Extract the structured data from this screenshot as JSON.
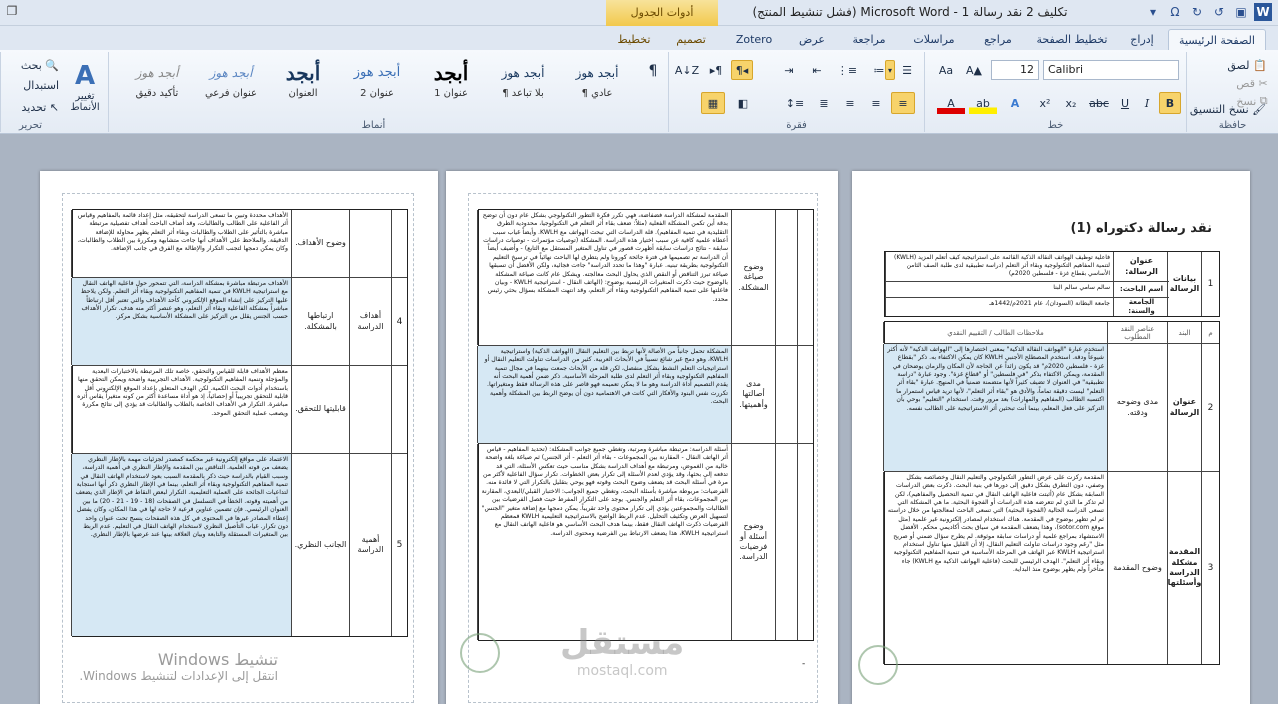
{
  "window": {
    "title": "تكليف 2 نقد رسالة 1 - Microsoft Word (فشل تنشيط المنتج)",
    "contextual_group": "أدوات الجدول"
  },
  "tabs": [
    {
      "label": "الصفحة الرئيسية",
      "active": true
    },
    {
      "label": "إدراج"
    },
    {
      "label": "تخطيط الصفحة"
    },
    {
      "label": "مراجع"
    },
    {
      "label": "مراسلات"
    },
    {
      "label": "مراجعة"
    },
    {
      "label": "عرض"
    },
    {
      "label": "Zotero"
    },
    {
      "label": "تصميم"
    },
    {
      "label": "تخطيط"
    }
  ],
  "ribbon": {
    "clipboard": {
      "label": "حافظة",
      "paste": "لصق",
      "cut": "قص",
      "copy": "نسخ",
      "format_painter": "نسخ التنسيق"
    },
    "font": {
      "label": "خط",
      "font_name": "Calibri",
      "font_size": "12"
    },
    "paragraph": {
      "label": "فقرة"
    },
    "styles": {
      "label": "أنماط",
      "items": [
        {
          "sample": "أبجد هوز",
          "name": "¶ عادي"
        },
        {
          "sample": "أبجد هوز",
          "name": "¶ بلا تباعد"
        },
        {
          "sample": "أبجد",
          "name": "عنوان 1"
        },
        {
          "sample": "أبجد هوز",
          "name": "عنوان 2"
        },
        {
          "sample": "أبجد",
          "name": "العنوان"
        },
        {
          "sample": "أبجد هوز",
          "name": "عنوان فرعي"
        },
        {
          "sample": "أبجد هوز",
          "name": "تأكيد دقيق"
        }
      ],
      "change_styles": "تغيير الأنماط"
    },
    "editing": {
      "label": "تحرير",
      "find": "بحث",
      "replace": "استبدال",
      "select": "تحديد"
    }
  },
  "document": {
    "page1": {
      "title": "نقد رسالة دكتوراه (1)",
      "info_rows": [
        {
          "num": "1",
          "section": "بيانات الرسالة",
          "fields": [
            {
              "label": "عنوان الرسالة:",
              "value": "فاعلية توظيف الهواتف النقالة الذكية القائمة على استراتيجية كيف أتعلم المزيد (KWLH) لتنمية المفاهيم التكنولوجية وبقاء أثر التعلم (دراسة تطبيقية لدى طلبة الصف الثامن الأساسي بقطاع غزة - فلسطين 2020م)"
            },
            {
              "label": "اسم الباحث:",
              "value": "سالم سامي سالم البنا"
            },
            {
              "label": "الجامعة والسنة:",
              "value": "جامعة البطانة (السودان)، عام 2021م/1442هـ"
            }
          ]
        }
      ],
      "eval_header": {
        "num": "م",
        "item": "البند",
        "criteria": "عناصر النقد المطلوب",
        "notes": "ملاحظات الطالب / التقييم النقدي"
      },
      "eval_rows": [
        {
          "num": "2",
          "item": "عنوان الرسالة",
          "criteria": "مدى وضوحه ودقته.",
          "text": "استخدم عبارة \"الهواتف النقالة الذكية\" بمعنى اختصارها إلى \"الهواتف الذكية\" لأنه أكثر شيوعاً ودقة. استخدم المصطلح الأجنبي KWLH كان يمكن الاكتفاء به. ذكر \"بقطاع غزة - فلسطين 2020م\" قد يكون زائداً عن الحاجة لأن المكان والزمان يوضحان في المقدمة، ويمكن الاكتفاء بذكر \"في فلسطين\" أو \"قطاع غزة\". وجود عبارة \"دراسة تطبيقية\" في العنوان لا تضيف كثيراً لأنها متضمنة ضمنياً في المنهج. عبارة \"بقاء أثر التعلم\" ليست دقيقة تماماً، والأدق هو \"بقاء أثر التعلم\"، لأنها تريد قياس استمرار ما اكتسبه الطالب (المفاهيم والمهارات) بعد مرور وقت. استخدام \"التعليم\" بوحي بأن التركيز على فعل المعلم، بينما أنت تبحثين أثر الاستراتيجية على الطالب نفسه.",
          "blue": true
        },
        {
          "num": "3",
          "item": "المقدمة مشكلة الدراسة وأسئلتها",
          "criteria": "وضوح المقدمة",
          "text": "المقدمة ركزت على عرض التطور التكنولوجي والتعليم النقال وخصائصه بشكل وصفي، دون التطرق بشكل دقيق إلى دورها في بنية البحث. ذكرت بعض الدراسات السابقة بشكل عام (أثبتت فاعلية الهاتف النقال في تنمية التحصيل والمفاهيم)، لكن لم تذكر ما الذي لم تتعرضه هذه الدراسات أو الفجوة البحثية. ما هي المشكلة التي تسعى الدراسة الحالية (الفجوة البحثية) التي تسعى الباحث لمعالجتها من خلال دراسته ثم لم تظهر بوضوح في المقدمة. هناك استخدام لمصادر إلكترونية غير علمية (مثل موقع sotor.com)، وهذا يضعف المقدمة في سياق بحث أكاديمي محكم. الأفضل الاستشهاد بمراجع علمية أو دراسات سابقة موثوقة. لم يطرح سؤال ضمني أو صريح مثل \"رغم وجود دراسات تناولت التعليم النقال، إلا أن القليل منها تناول استخدام استراتيجية KWLH عبر الهاتف في المرحلة الأساسية في تنمية المفاهيم التكنولوجية وبقاء أثر التعلم\". الهدف الرئيسي للبحث (فاعلية الهواتف الذكية مع KWLH) جاء متأخراً ولم يظهر بوضوح منذ البداية.",
          "blue": false
        }
      ]
    },
    "page2": {
      "rows": [
        {
          "criteria": "وضوح صياغة المشكلة.",
          "text": "المقدمة لمشكلة الدراسة فضفاضة، فهي تكرر فكرة التطور التكنولوجي بشكل عام دون أن توضح بدقة أين تكمن المشكلة الفعلية (مثلاً: ضعف بقاء أثر التعلم في التكنولوجيا، محدودية الطرق التقليدية في تنمية المفاهيم). قلة الدراسات التي تبحث الهواتف مع KWLH. وأيضاً غياب سبب أعطاه علمية كافية عن سبب اختيار هذه الدراسة. المشكلة (توصيات مؤتمرات - توصيات دراسات سابقة - نتائج دراسات سابقة أظهرت قصور في تناول المتغير المستقل مع التابع) - وأضيف أيضاً أن الدراسة تم تصميمها في فترة جائحة كورونا ولم يتطرق لها الباحث نهائياً في ترسيخ التعليم التكنولوجية بطريقة تبنيه. عبارة \"وهذا ما تحدد الدراسة\" جاءت فجائية، ولكن الأفضل أن تسبقها صياغة تبرز التناقض أو النقص الذي يحاول البحث معالجته. ويشكل عام كانت صياغة المشكلة بالوضوح حيث ذكرت المتغيرات الرئيسية بوضوح: (الهاتف النقال - استراتيجية KWLH - وبيان فاعلتها على تنمية المفاهيم التكنولوجية وبقاء أثر التعلم، وقد انتهت المشكلة بسؤال بحثي رئيس محدد.",
          "blue": false
        },
        {
          "criteria": "مدى أصالتها وأهميتها.",
          "text": "المشكلة تحمل جانباً من الأصالة لأنها تربط بين التعليم النقال (الهواتف الذكية) واستراتيجية KWLH، وهو دمج غير شائع نسبياً في الأبحاث العربية. كثير من الدراسات تناولت التعليم النقال أو استراتيجيات التعلم النشط بشكل منفصل، لكن قلة من الأبحاث جمعت بينهما في مجال تنمية المفاهيم التكنولوجية وبقاء أثر التعلم لدى طلبة المرحلة الأساسية. ذكر ضمن أهمية البحث أنه يقدم التصميم أداة الدراسة وهو ما لا يمكن تعميمه فهو قاصر على هذه الرسالة فقط ومتغيراتها. تكررت نفس البنود والأفكار التي كانت في الاهتمامية دون أن يوضح الربط بين المشكلة وأهمية البحث.",
          "blue": true
        },
        {
          "criteria": "وضوح أسئلة أو فرضيات الدراسة.",
          "text": "أسئلة الدراسة: مرتبطة مباشرة ومرتبة، وتغطي جميع جوانب المشكلة: (تحديد المفاهيم - قياس أثر الهاتف النقال - المقارنة بين المجموعات - بقاء أثر التعلم - أثر الجنس) ثم صياغة بلغة واضحة خالية من الغموض، ومرتبطة مع أهداف الدراسة بشكل مناسب حيث تعكس الأسئلة، التي قد تدفعه إلى بحثها، وقد يؤدي لعدم الأسئلة إلى تكرار بعض الخطوات. تكرار سؤال الفاعلية لأكثر من مرة في أسئلة البحث قد يضعف وضوح البحث وقوته فهو يوحي بتقليل بالتكرار التي لا فائدة منه. الفرضيات: مربوطة مباشرة بأسئلة البحث، وتغطي جميع الجوانب: الاختبار القبلي/البعدي، المقارنة بين المجموعات، بقاء أثر التعلم والجنس. يوجد على التكرار المفرط حيث فصل الفرضيات بين الطالبات والمجموعتين يؤدي إلى تكرار محتوى واحد تقريباً. يمكن دمجها مع إضافة متغير \"الجنس\" لتسهيل العرض وتكثيف التحليل. عدم الربط الواضح بالاستراتيجية التعليمية KWLH فمعظم الفرضيات ذكرت الهاتف النقال فقط، بينما هدف البحث الأساسي هو فاعلية الهاتف النقال مع استراتيجية KWLH، هذا يضعف الارتباط بين الفرضية ومحتوى الدراسة.",
          "blue": false
        }
      ],
      "footer_dash": "-"
    },
    "page3": {
      "rows": [
        {
          "num": "",
          "item": "",
          "criteria": "وضوح الأهداف.",
          "text": "الأهداف محددة وتبين ما تسعى الدراسة لتحقيقه، مثل إعداد قائمة بالمفاهيم وقياس أثر الفاعلية على الطالب والطالبات، وقد أضاف الباحث أهداف تفصيلية مرتبطة مباشرة بالتأثير على الطلاب والطالبات وبقاء أثر التعلم يظهر محاولة للإضافة الدقيقة. والملاحظ على الأهداف أنها جاءت متشابهة ومكررة بين الطلاب والطالبات، وكان يمكن دمجها لتجنب التكرار والإطالة مع الفرق في جانب الإضافة.",
          "blue": false
        },
        {
          "num": "4",
          "item": "أهداف الدراسة",
          "criteria": "ارتباطها بالمشكلة.",
          "text": "الأهداف مرتبطة مباشرة بمشكلة الدراسة، التي تتمحور حول فاعلية الهاتف النقال مع استراتيجية KWLH في تنمية المفاهيم التكنولوجية وبقاء أثر التعلم. ولكن يلاحظ عليها التركيز على إنشاء الموقع الإلكتروني كأحد الأهداف والتي تعتبر أقل ارتباطاً مباشراً بمشكلة الفاعلية وبقاء أثر التعلم، وهو عنصر أكثر منه هدف. تكرار الأهداف حسب الجنس يقلل من التركيز على المشكلة الأساسية بشكل مركز.",
          "blue": true
        },
        {
          "num": "",
          "item": "",
          "criteria": "قابليتها للتحقق.",
          "text": "معظم الأهداف قابلة للقياس والتحقق، خاصة تلك المرتبطة بالاختبارات البعدية والمؤجلة وتنمية المفاهيم التكنولوجية. الأهداف التجريبية واضحة ويمكن التحقق منها باستخدام أدوات البحث الكمية. لكن الهدف المتعلق بإعداد الموقع الإلكتروني أقل قابلية للتحقق تجريبياً أو إحصائياً، إذ هو أداة مساعدة أكثر من كونه متغيراً يقاس أثره مباشرة. التكرار في الأهداف الخاصة بالطلاب والطالبات قد يؤدي إلى نتائج مكررة ويصعب عملية التحقق الموحد.",
          "blue": false
        },
        {
          "num": "5",
          "item": "أهمية الدراسة",
          "criteria": "الجانب النظري.",
          "text": "الاعتماد على مواقع إلكترونية غير محكمة كمصدر لجزئيات مهمة بالإطار النظري يضعف من قوته العلمية. التناقض بين المقدمة والإطار النظري في أهمية الدراسة، وسبب القيام بالدراسة حيث ذكر بالمقدمة السبب بعود لاستخدام الهاتف النقال في تنمية المفاهيم التكنولوجية وبقاء أثر التعلم، بينما في الإطار النظري ذكر أنها استجابة لتداعيات الجائحة على العملية التعليمية. التكرار لبعض النقاط في الإطار الذي يضعف من أهميته وقوته. الخطأ في التسلسل في الصفحات (18 - 19 - 21 - 20) ما بين العنوان الرئيسي. فإن تضمين عناوين فرعية لا حاجة لها في هذا المكان، وكان يفضل إعطاء المصادر غيرها في المحتوى في كل هذه الصفحات ينسج تحت عنوان واحد دون تكرار. غياب التأصيل النظري لاستخدام الهاتف النقال في التعليم. عدم الربط بين المتغيرات المستقلة والتابعة وبيان العلاقة بينها عند عرضها بالإطار النظري.",
          "blue": true
        }
      ]
    }
  },
  "overlays": {
    "watermark_big": "مستقل",
    "watermark_small": "mostaql.com",
    "activation_title": "تنشيط Windows",
    "activation_sub": "انتقل إلى الإعدادات لتنشيط Windows."
  }
}
